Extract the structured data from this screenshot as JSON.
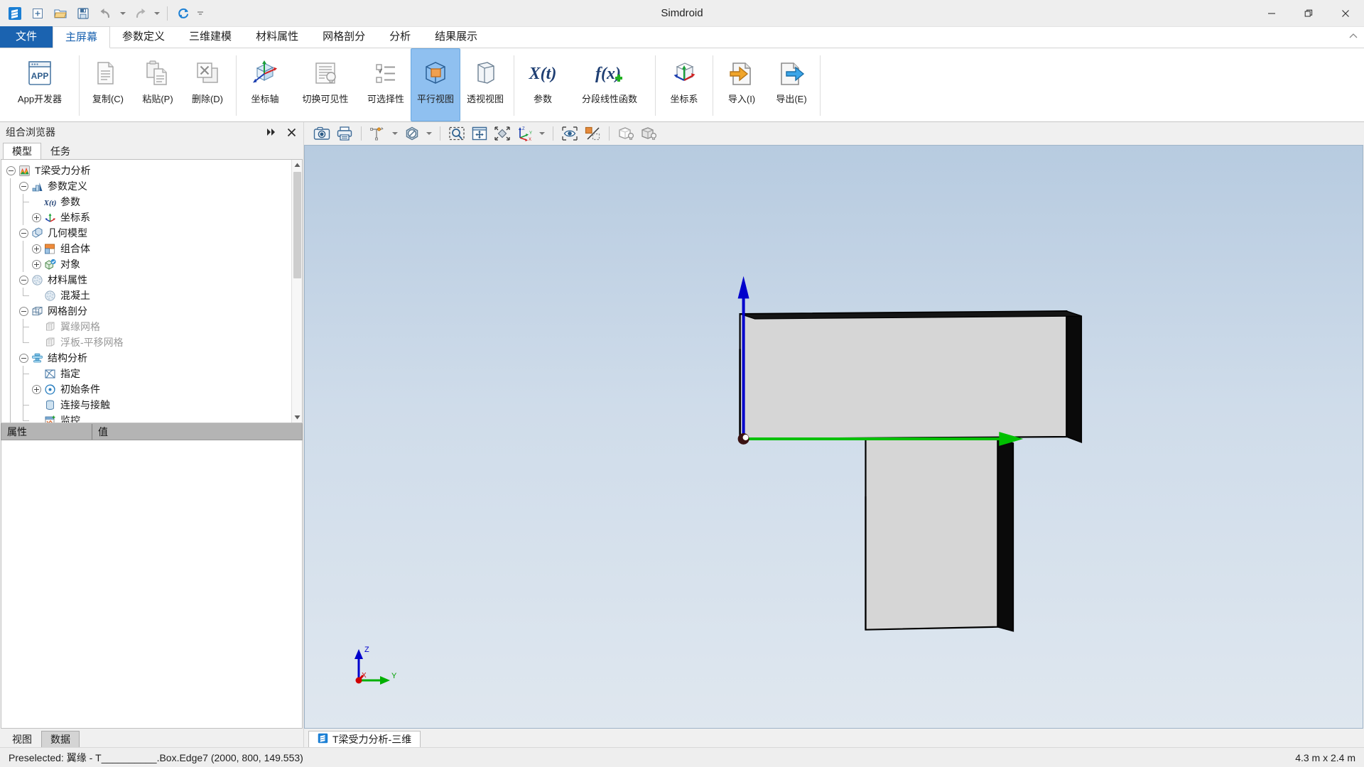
{
  "window": {
    "title": "Simdroid",
    "minimize_label": "—",
    "restore_label": "❐",
    "close_label": "✕"
  },
  "quick_access": {
    "items": [
      {
        "name": "app-logo-icon",
        "label": "Simdroid"
      },
      {
        "name": "new-icon",
        "label": "新建"
      },
      {
        "name": "open-folder-icon",
        "label": "打开"
      },
      {
        "name": "save-icon",
        "label": "保存"
      },
      {
        "name": "undo-icon",
        "label": "撤销"
      },
      {
        "name": "redo-icon",
        "label": "重做"
      },
      {
        "name": "refresh-icon",
        "label": "刷新"
      }
    ]
  },
  "ribbon": {
    "tabs": [
      {
        "label": "文件",
        "kind": "file"
      },
      {
        "label": "主屏幕",
        "kind": "active"
      },
      {
        "label": "参数定义",
        "kind": "normal"
      },
      {
        "label": "三维建模",
        "kind": "normal"
      },
      {
        "label": "材料属性",
        "kind": "normal"
      },
      {
        "label": "网格剖分",
        "kind": "normal"
      },
      {
        "label": "分析",
        "kind": "normal"
      },
      {
        "label": "结果展示",
        "kind": "normal"
      }
    ],
    "groups": [
      {
        "buttons": [
          {
            "label": "App开发器",
            "icon": "app-developer-icon",
            "width": "wide",
            "selected": false
          }
        ]
      },
      {
        "buttons": [
          {
            "label": "复制(C)",
            "icon": "copy-icon",
            "width": "normal",
            "selected": false
          },
          {
            "label": "粘贴(P)",
            "icon": "paste-icon",
            "width": "normal",
            "selected": false
          },
          {
            "label": "删除(D)",
            "icon": "delete-icon",
            "width": "normal",
            "selected": false
          }
        ]
      },
      {
        "buttons": [
          {
            "label": "坐标轴",
            "icon": "axis-icon",
            "width": "normal",
            "selected": false
          },
          {
            "label": "切换可见性",
            "icon": "toggle-visibility-icon",
            "width": "wide",
            "selected": false
          },
          {
            "label": "可选择性",
            "icon": "selectability-icon",
            "width": "normal",
            "selected": false
          },
          {
            "label": "平行视图",
            "icon": "parallel-view-icon",
            "width": "normal",
            "selected": true
          },
          {
            "label": "透视视图",
            "icon": "perspective-view-icon",
            "width": "normal",
            "selected": false
          }
        ]
      },
      {
        "buttons": [
          {
            "label": "参数",
            "icon": "parameter-xt-icon",
            "width": "normal",
            "selected": false
          },
          {
            "label": "分段线性函数",
            "icon": "piecewise-fx-icon",
            "width": "xwide",
            "selected": false
          }
        ]
      },
      {
        "buttons": [
          {
            "label": "坐标系",
            "icon": "coordinate-system-icon",
            "width": "normal",
            "selected": false
          }
        ]
      },
      {
        "buttons": [
          {
            "label": "导入(I)",
            "icon": "import-icon",
            "width": "normal",
            "selected": false
          },
          {
            "label": "导出(E)",
            "icon": "export-icon",
            "width": "normal",
            "selected": false
          }
        ]
      }
    ]
  },
  "browser_panel": {
    "title": "组合浏览器",
    "collapse_label": "»",
    "close_label": "✕",
    "tabs": [
      {
        "label": "模型",
        "active": true
      },
      {
        "label": "任务",
        "active": false
      }
    ],
    "tree": [
      {
        "label": "T梁受力分析",
        "depth": 0,
        "expander": "minus",
        "icon": "project-icon",
        "dim": false
      },
      {
        "label": "参数定义",
        "depth": 1,
        "expander": "minus",
        "icon": "parameter-def-icon",
        "dim": false
      },
      {
        "label": "参数",
        "depth": 2,
        "expander": "none",
        "icon": "xt-icon",
        "dim": false
      },
      {
        "label": "坐标系",
        "depth": 2,
        "expander": "plus",
        "icon": "axes-icon",
        "dim": false
      },
      {
        "label": "几何模型",
        "depth": 1,
        "expander": "minus",
        "icon": "geometry-icon",
        "dim": false
      },
      {
        "label": "组合体",
        "depth": 2,
        "expander": "plus",
        "icon": "assembly-icon",
        "dim": false
      },
      {
        "label": "对象",
        "depth": 2,
        "expander": "plus",
        "icon": "object-icon",
        "dim": false
      },
      {
        "label": "材料属性",
        "depth": 1,
        "expander": "minus",
        "icon": "material-icon",
        "dim": false
      },
      {
        "label": "混凝土",
        "depth": 2,
        "expander": "none",
        "icon": "material-item-icon",
        "dim": false
      },
      {
        "label": "网格剖分",
        "depth": 1,
        "expander": "minus",
        "icon": "mesh-icon",
        "dim": false
      },
      {
        "label": "翼缘网格",
        "depth": 2,
        "expander": "none",
        "icon": "mesh-item-icon",
        "dim": true
      },
      {
        "label": "浮板-平移网格",
        "depth": 2,
        "expander": "none",
        "icon": "mesh-item-icon",
        "dim": true
      },
      {
        "label": "结构分析",
        "depth": 1,
        "expander": "minus",
        "icon": "structural-analysis-icon",
        "dim": false
      },
      {
        "label": "指定",
        "depth": 2,
        "expander": "none",
        "icon": "assign-icon",
        "dim": false
      },
      {
        "label": "初始条件",
        "depth": 2,
        "expander": "plus",
        "icon": "initial-condition-icon",
        "dim": false
      },
      {
        "label": "连接与接触",
        "depth": 2,
        "expander": "none",
        "icon": "connection-contact-icon",
        "dim": false
      },
      {
        "label": "监控",
        "depth": 2,
        "expander": "none",
        "icon": "monitor-icon",
        "dim": false
      }
    ]
  },
  "property_panel": {
    "columns": [
      "属性",
      "值"
    ],
    "rows": []
  },
  "left_bottom_tabs": [
    {
      "label": "视图",
      "active": false
    },
    {
      "label": "数据",
      "active": true
    }
  ],
  "view_toolbar": {
    "items": [
      {
        "name": "screenshot-icon",
        "label": "截图",
        "caret": false
      },
      {
        "name": "print-icon",
        "label": "打印",
        "caret": false
      },
      {
        "name": "measure-icon",
        "label": "测量",
        "caret": true
      },
      {
        "name": "no-entry-icon",
        "label": "禁用",
        "caret": true
      },
      {
        "name": "zoom-box-icon",
        "label": "框选缩放",
        "caret": false
      },
      {
        "name": "pan-icon",
        "label": "平移",
        "caret": false
      },
      {
        "name": "fit-all-icon",
        "label": "满屏显示",
        "caret": false
      },
      {
        "name": "view-orientation-icon",
        "label": "视向",
        "caret": true
      },
      {
        "name": "show-hide-icon",
        "label": "显示隐藏",
        "caret": false
      },
      {
        "name": "edge-face-toggle-icon",
        "label": "边面显示",
        "caret": false
      },
      {
        "name": "shading-light-icon",
        "label": "渲染光照",
        "caret": false
      },
      {
        "name": "solid-light-icon",
        "label": "实体光照",
        "caret": false
      }
    ]
  },
  "viewport": {
    "document_tab": "T梁受力分析-三维",
    "document_tab_icon": "simdroid-doc-icon",
    "triad": {
      "z_label": "Z",
      "y_label": "Y",
      "x_label": "X",
      "z_color": "#0000d0",
      "y_color": "#00b000",
      "x_color": "#d00000"
    },
    "origin_arrows": {
      "vertical_color": "#0000cc",
      "horizontal_color": "#00cc00"
    },
    "model_name": "T-beam",
    "face_color": "#d4d4d4",
    "edge_color": "#000000",
    "background_top": "#b7cbe0",
    "background_bottom": "#dfe7ef"
  },
  "statusbar": {
    "message": "Preselected: 翼缘 - T__________.Box.Edge7 (2000, 800, 149.553)",
    "dimensions": "4.3 m x 2.4 m"
  },
  "colors": {
    "accent": "#1b63b0",
    "ribbon_selected": "#8fc0f0",
    "panel_bg": "#f0f0f0",
    "prop_header": "#b4b4b4"
  }
}
